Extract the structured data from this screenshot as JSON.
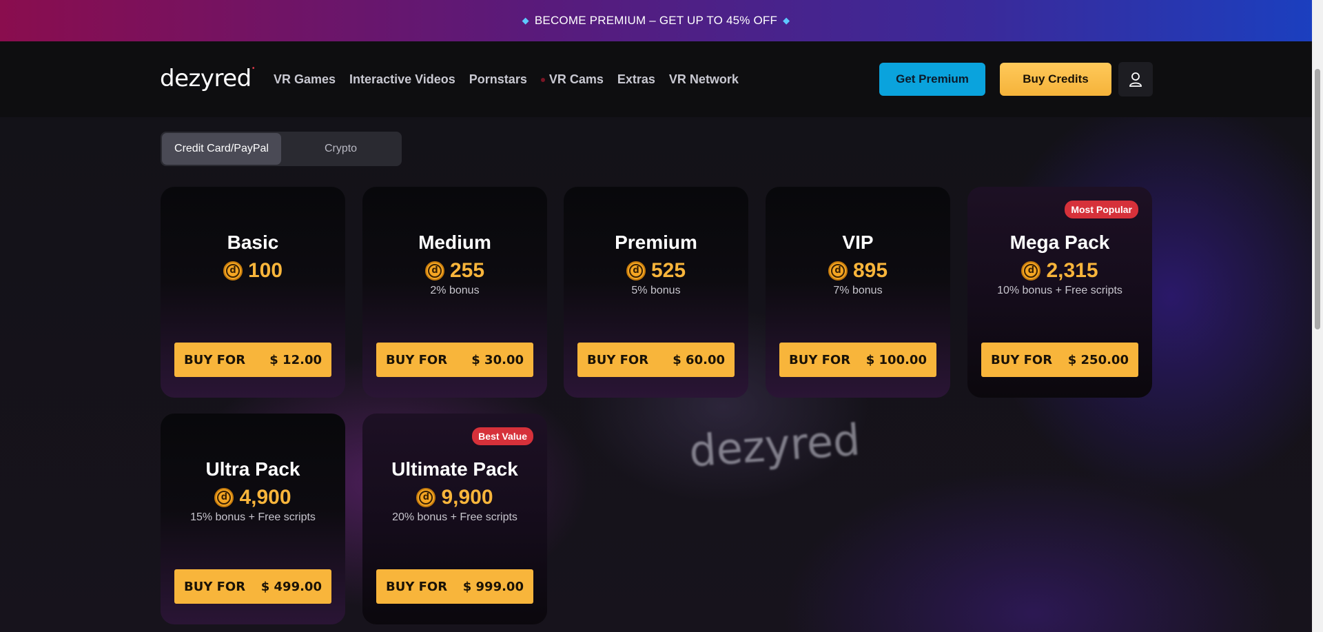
{
  "promo": {
    "text": "BECOME PREMIUM – GET UP TO 45% OFF",
    "icon": "diamond-icon",
    "color": "#5ec8ff"
  },
  "header": {
    "logo": "dezyred",
    "nav": [
      {
        "label": "VR Games"
      },
      {
        "label": "Interactive Videos"
      },
      {
        "label": "Pornstars"
      },
      {
        "label": "VR Cams"
      },
      {
        "label": "Extras"
      },
      {
        "label": "VR Network"
      }
    ],
    "premium_button": "Get Premium",
    "credits_button": "Buy Credits",
    "user_icon": "user-icon"
  },
  "payment_tabs": [
    {
      "label": "Credit Card/PayPal",
      "active": true
    },
    {
      "label": "Crypto",
      "active": false
    }
  ],
  "background_logo": "dezyred",
  "packs": [
    {
      "name": "Basic",
      "credits": "100",
      "bonus": "",
      "buy_label": "BUY FOR",
      "price": "$ 12.00",
      "badge": ""
    },
    {
      "name": "Medium",
      "credits": "255",
      "bonus": "2% bonus",
      "buy_label": "BUY FOR",
      "price": "$ 30.00",
      "badge": ""
    },
    {
      "name": "Premium",
      "credits": "525",
      "bonus": "5% bonus",
      "buy_label": "BUY FOR",
      "price": "$ 60.00",
      "badge": ""
    },
    {
      "name": "VIP",
      "credits": "895",
      "bonus": "7% bonus",
      "buy_label": "BUY FOR",
      "price": "$ 100.00",
      "badge": ""
    },
    {
      "name": "Mega Pack",
      "credits": "2,315",
      "bonus": "10% bonus + Free scripts",
      "buy_label": "BUY FOR",
      "price": "$ 250.00",
      "badge": "Most Popular"
    },
    {
      "name": "Ultra Pack",
      "credits": "4,900",
      "bonus": "15% bonus + Free scripts",
      "buy_label": "BUY FOR",
      "price": "$ 499.00",
      "badge": ""
    },
    {
      "name": "Ultimate Pack",
      "credits": "9,900",
      "bonus": "20% bonus + Free scripts",
      "buy_label": "BUY FOR",
      "price": "$ 999.00",
      "badge": "Best Value"
    }
  ],
  "colors": {
    "accent": "#f8b53b",
    "premium": "#0aa3dd",
    "badge": "#d6313a"
  }
}
